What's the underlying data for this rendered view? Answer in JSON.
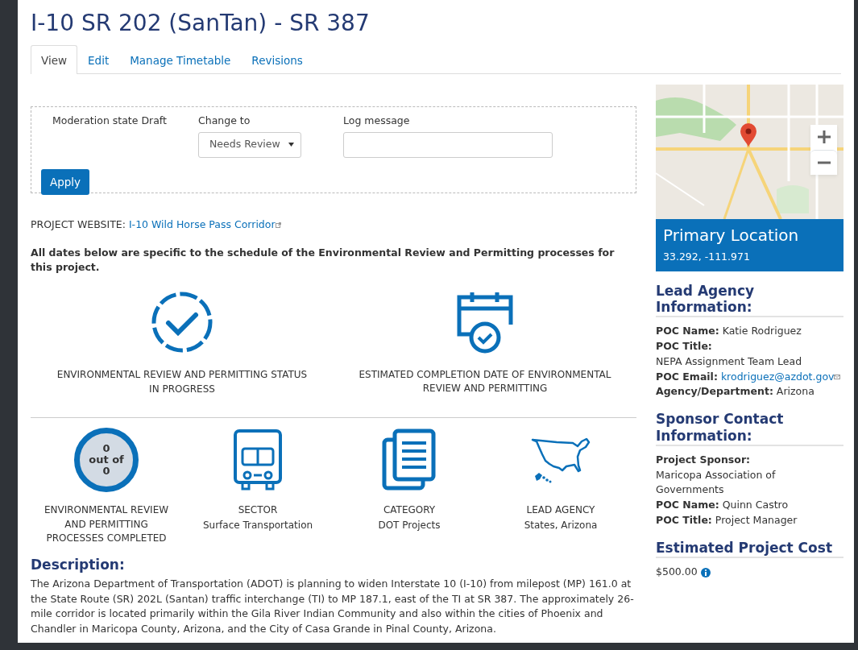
{
  "title": "I-10 SR 202 (SanTan) - SR 387",
  "tabs": [
    {
      "label": "View",
      "selected": true
    },
    {
      "label": "Edit",
      "selected": false
    },
    {
      "label": "Manage Timetable",
      "selected": false
    },
    {
      "label": "Revisions",
      "selected": false
    }
  ],
  "moderation": {
    "state_label": "Moderation state Draft",
    "change_label": "Change to",
    "change_value": "Needs Review",
    "log_label": "Log message",
    "apply": "Apply"
  },
  "project_website": {
    "label": "PROJECT WEBSITE:",
    "link": "I-10 Wild Horse Pass Corridor"
  },
  "dates_note": "All dates below are specific to the schedule of the Environmental Review and Permitting processes for this project.",
  "status_items": [
    {
      "kind": "status",
      "label": "ENVIRONMENTAL REVIEW AND PERMITTING STATUS",
      "value": "IN PROGRESS"
    },
    {
      "kind": "calendar",
      "label": "ESTIMATED COMPLETION DATE OF ENVIRONMENTAL REVIEW AND PERMITTING"
    }
  ],
  "facts": [
    {
      "kind": "counter",
      "counter": [
        "0",
        "out of",
        "0"
      ],
      "label": "ENVIRONMENTAL REVIEW AND PERMITTING PROCESSES COMPLETED"
    },
    {
      "kind": "truck",
      "label": "SECTOR",
      "value": "Surface Transportation"
    },
    {
      "kind": "documents",
      "label": "CATEGORY",
      "value": "DOT Projects"
    },
    {
      "kind": "country",
      "label": "LEAD AGENCY",
      "value": "States, Arizona"
    }
  ],
  "description": {
    "heading": "Description:",
    "text": "The Arizona Department of Transportation (ADOT) is planning to widen Interstate 10 (I-10) from milepost (MP) 161.0 at the State Route (SR) 202L (Santan) traffic interchange (TI) to MP 187.1, east of the TI at SR 387. The approximately 26-mile corridor is located primarily within the Gila River Indian Community and also within the cities of Phoenix and Chandler in Maricopa County, Arizona, and the City of Casa Grande in Pinal County, Arizona."
  },
  "location": {
    "title": "Primary Location",
    "coords": "33.292, -111.971"
  },
  "sections": [
    {
      "heading": "Lead Agency Information:",
      "fields": [
        {
          "label": "POC Name:",
          "value": "Katie Rodriguez",
          "kind": "text",
          "block": false
        },
        {
          "label": "POC Title:",
          "value": "NEPA Assignment Team Lead",
          "kind": "text",
          "block": true
        },
        {
          "label": "POC Email:",
          "value": "krodriguez@azdot.gov",
          "kind": "email",
          "block": false
        },
        {
          "label": "Agency/Department:",
          "value": "Arizona",
          "kind": "text",
          "block": false
        }
      ]
    },
    {
      "heading": "Sponsor Contact Information:",
      "fields": [
        {
          "label": "Project Sponsor:",
          "value": "Maricopa Association of Governments",
          "kind": "text",
          "block": true
        },
        {
          "label": "POC Name:",
          "value": "Quinn Castro",
          "kind": "text",
          "block": false
        },
        {
          "label": "POC Title:",
          "value": "Project Manager",
          "kind": "text",
          "block": false
        }
      ]
    },
    {
      "heading": "Estimated Project Cost",
      "fields": [
        {
          "value": "$500.00",
          "kind": "cost",
          "block": false
        }
      ]
    }
  ]
}
